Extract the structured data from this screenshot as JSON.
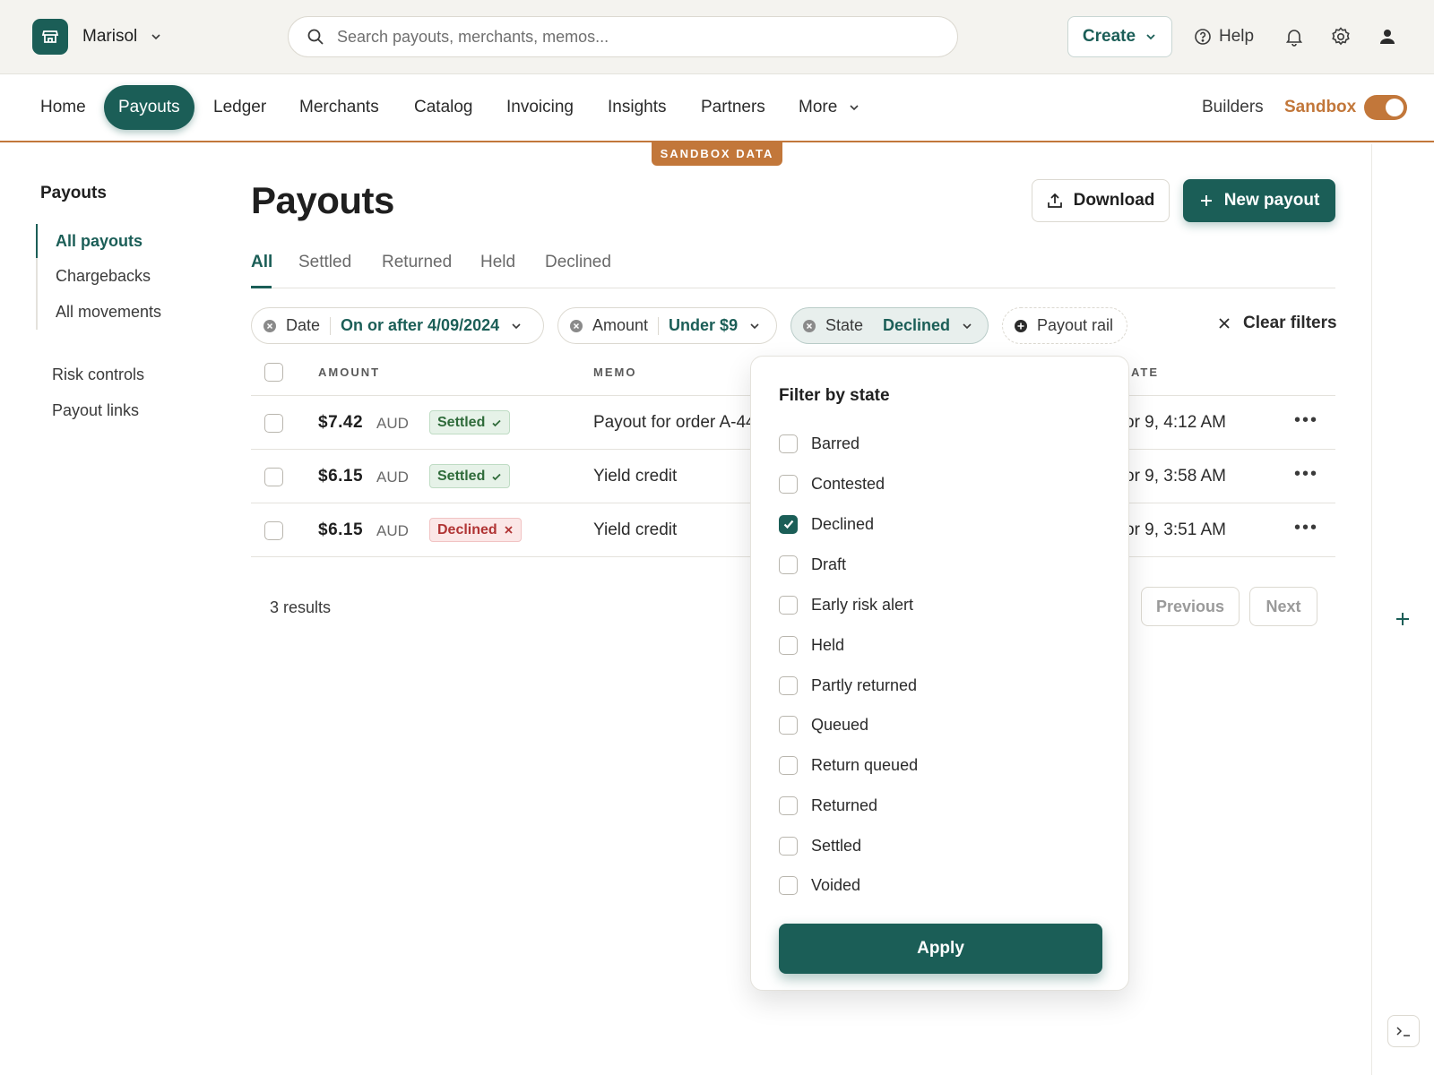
{
  "account": {
    "name": "Marisol",
    "icon": "store-icon"
  },
  "search": {
    "placeholder": "Search payouts, merchants, memos..."
  },
  "top_actions": {
    "create_label": "Create",
    "help_label": "Help"
  },
  "nav": {
    "items": [
      "Home",
      "Payouts",
      "Ledger",
      "Merchants",
      "Catalog",
      "Invoicing",
      "Insights",
      "Partners",
      "More"
    ],
    "active": "Payouts",
    "builders_label": "Builders",
    "sandbox_label": "Sandbox",
    "sandbox_on": true
  },
  "sandbox_banner": "SANDBOX DATA",
  "sidebar": {
    "title": "Payouts",
    "group_items": [
      "All payouts",
      "Chargebacks",
      "All movements"
    ],
    "active": "All payouts",
    "items": [
      "Risk controls",
      "Payout links"
    ]
  },
  "page": {
    "title": "Payouts",
    "download_label": "Download",
    "new_label": "New payout"
  },
  "tabs": [
    "All",
    "Settled",
    "Returned",
    "Held",
    "Declined"
  ],
  "active_tab": "All",
  "filters": {
    "date": {
      "label": "Date",
      "value": "On or after 4/09/2024"
    },
    "amount": {
      "label": "Amount",
      "value": "Under $9"
    },
    "state": {
      "label": "State",
      "value": "Declined"
    },
    "payout_rail": {
      "label": "Payout rail"
    },
    "clear_label": "Clear filters"
  },
  "table": {
    "headers": {
      "amount": "AMOUNT",
      "memo": "MEMO",
      "date": "ATE"
    },
    "rows": [
      {
        "amount": "$7.42",
        "currency": "AUD",
        "status": "Settled",
        "memo": "Payout for order A-44",
        "date": "or 9, 4:12 AM"
      },
      {
        "amount": "$6.15",
        "currency": "AUD",
        "status": "Settled",
        "memo": "Yield credit",
        "date": "or 9, 3:58 AM"
      },
      {
        "amount": "$6.15",
        "currency": "AUD",
        "status": "Declined",
        "memo": "Yield credit",
        "date": "or 9, 3:51 AM"
      }
    ],
    "results": "3 results",
    "previous_label": "Previous",
    "next_label": "Next"
  },
  "state_filter": {
    "title": "Filter by state",
    "options": [
      {
        "label": "Barred",
        "checked": false
      },
      {
        "label": "Contested",
        "checked": false
      },
      {
        "label": "Declined",
        "checked": true
      },
      {
        "label": "Draft",
        "checked": false
      },
      {
        "label": "Early risk alert",
        "checked": false
      },
      {
        "label": "Held",
        "checked": false
      },
      {
        "label": "Partly returned",
        "checked": false
      },
      {
        "label": "Queued",
        "checked": false
      },
      {
        "label": "Return queued",
        "checked": false
      },
      {
        "label": "Returned",
        "checked": false
      },
      {
        "label": "Settled",
        "checked": false
      },
      {
        "label": "Voided",
        "checked": false
      }
    ],
    "apply_label": "Apply"
  },
  "colors": {
    "brand": "#1b5e57",
    "sandbox": "#c2773a",
    "settled": "#2f6b3a",
    "declined": "#b03434"
  }
}
